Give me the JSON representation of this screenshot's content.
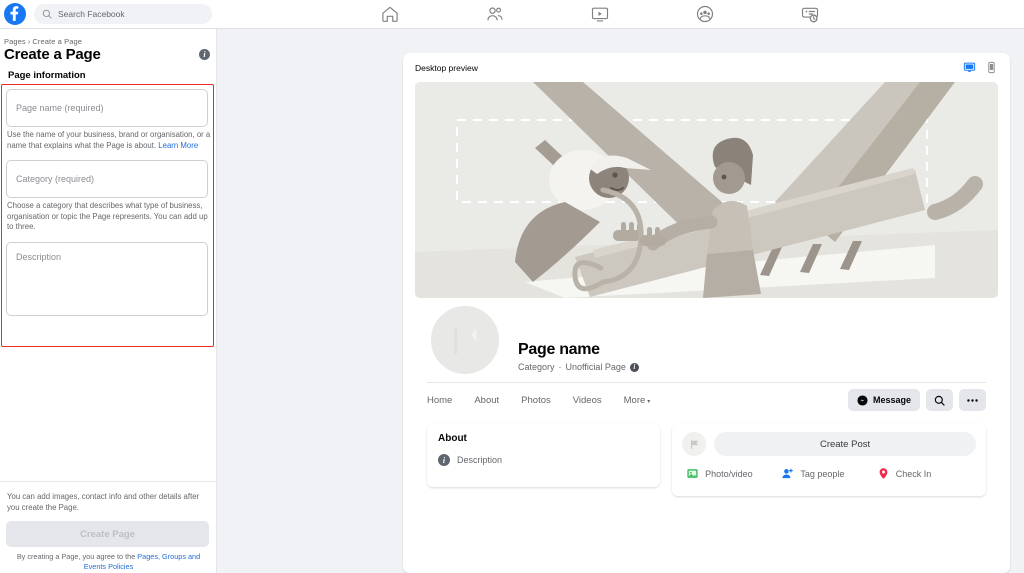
{
  "topbar": {
    "logo_icon": "facebook-logo-icon",
    "search_placeholder": "Search Facebook",
    "search_icon": "search-icon",
    "nav": [
      {
        "icon": "home-icon",
        "name": "nav-home"
      },
      {
        "icon": "friends-icon",
        "name": "nav-friends"
      },
      {
        "icon": "watch-icon",
        "name": "nav-watch"
      },
      {
        "icon": "groups-icon",
        "name": "nav-groups"
      },
      {
        "icon": "gaming-icon",
        "name": "nav-gaming"
      }
    ]
  },
  "sidebar": {
    "breadcrumb_root": "Pages",
    "breadcrumb_sep": "›",
    "breadcrumb_current": "Create a Page",
    "title": "Create a Page",
    "info_icon": "info-icon",
    "section_heading": "Page information",
    "fields": {
      "page_name_placeholder": "Page name (required)",
      "page_name_value": "",
      "page_name_helper": "Use the name of your business, brand or organisation, or a name that explains what the Page is about. ",
      "page_name_helper_link": "Learn More",
      "category_placeholder": "Category (required)",
      "category_value": "",
      "category_helper": "Choose a category that describes what type of business, organisation or topic the Page represents. You can add up to three.",
      "description_placeholder": "Description",
      "description_value": ""
    },
    "footer_note": "You can add images, contact info and other details after you create the Page.",
    "create_button": "Create Page",
    "terms_prefix": "By creating a Page, you agree to the ",
    "terms_link": "Pages, Groups and Events Policies",
    "highlight_color": "#ee2a24"
  },
  "preview": {
    "header_label": "Desktop preview",
    "desktop_icon": "desktop-monitor-icon",
    "mobile_icon": "mobile-phone-icon",
    "desktop_icon_color": "#1877f2",
    "mobile_icon_color": "#8a8d91",
    "cover_illustration": "people-building-page-illustration",
    "avatar_icon": "flag-icon",
    "page_name": "Page name",
    "subtitle_category": "Category",
    "subtitle_sep": "·",
    "subtitle_status": "Unofficial Page",
    "subtitle_info_icon": "info-icon",
    "tabs": [
      {
        "label": "Home",
        "name": "tab-home"
      },
      {
        "label": "About",
        "name": "tab-about"
      },
      {
        "label": "Photos",
        "name": "tab-photos"
      },
      {
        "label": "Videos",
        "name": "tab-videos"
      },
      {
        "label": "More",
        "name": "tab-more",
        "caret": "▾"
      }
    ],
    "message_button": "Message",
    "message_icon": "messenger-icon",
    "search_icon": "search-icon",
    "more_icon": "ellipsis-icon",
    "about_card": {
      "heading": "About",
      "description": "Description",
      "info_icon": "info-icon"
    },
    "post_card": {
      "avatar_icon": "flag-icon",
      "create_post": "Create Post",
      "actions": [
        {
          "label": "Photo/video",
          "icon": "photo-video-icon",
          "color": "#45bd62",
          "name": "photo-video-action"
        },
        {
          "label": "Tag people",
          "icon": "tag-people-icon",
          "color": "#1877f2",
          "name": "tag-people-action"
        },
        {
          "label": "Check In",
          "icon": "check-in-icon",
          "color": "#f02849",
          "name": "check-in-action"
        }
      ]
    }
  }
}
